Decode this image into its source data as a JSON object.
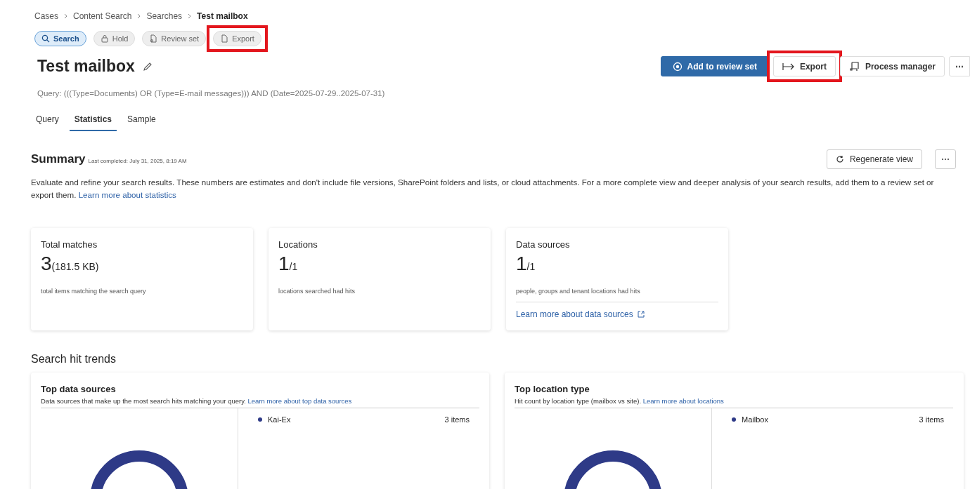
{
  "breadcrumb": [
    {
      "label": "Cases",
      "current": false
    },
    {
      "label": "Content Search",
      "current": false
    },
    {
      "label": "Searches",
      "current": false
    },
    {
      "label": "Test mailbox",
      "current": true
    }
  ],
  "pills": [
    {
      "label": "Search",
      "kind": "search",
      "selected": true,
      "highlighted": false
    },
    {
      "label": "Hold",
      "kind": "hold",
      "selected": false,
      "highlighted": false
    },
    {
      "label": "Review set",
      "kind": "review",
      "selected": false,
      "highlighted": false
    },
    {
      "label": "Export",
      "kind": "export",
      "selected": false,
      "highlighted": true
    }
  ],
  "title": "Test mailbox",
  "actions": [
    {
      "label": "Add to review set",
      "kind": "add",
      "primary": true,
      "highlighted": false
    },
    {
      "label": "Export",
      "kind": "export",
      "primary": false,
      "highlighted": true
    },
    {
      "label": "Process manager",
      "kind": "process",
      "primary": false,
      "highlighted": false
    },
    {
      "label": "⋯",
      "kind": "more",
      "primary": false,
      "highlighted": false
    }
  ],
  "query": "Query: (((Type=Documents) OR (Type=E-mail messages))) AND (Date=2025-07-29..2025-07-31)",
  "tabs": [
    {
      "label": "Query",
      "selected": false
    },
    {
      "label": "Statistics",
      "selected": true
    },
    {
      "label": "Sample",
      "selected": false
    }
  ],
  "summary": {
    "heading": "Summary",
    "last_completed": "Last completed: July 31, 2025, 8:19 AM",
    "regenerate": "Regenerate view",
    "more": "⋯",
    "description": "Evaluate and refine your search results. These numbers are estimates and don't include file versions, SharePoint folders and lists, or cloud attachments. For a more complete view and deeper analysis of your search results, add them to a review set or export them.",
    "link": "Learn more about statistics"
  },
  "cards": [
    {
      "title": "Total matches",
      "big": "3",
      "small": "(181.5 KB)",
      "caption": "total items matching the search query"
    },
    {
      "title": "Locations",
      "big": "1",
      "small": "/1",
      "caption": "locations searched had hits"
    },
    {
      "title": "Data sources",
      "big": "1",
      "small": "/1",
      "caption": "people, groups and tenant locations had hits",
      "link": "Learn more about data sources"
    }
  ],
  "trends_heading": "Search hit trends",
  "panels": [
    {
      "title": "Top data sources",
      "description": "Data sources that make up the most search hits matching your query.",
      "link": "Learn more about top data sources",
      "legend": [
        {
          "label": "Kai-Ex",
          "value": "3 items",
          "color": "#2e3a87"
        }
      ]
    },
    {
      "title": "Top location type",
      "description": "Hit count by location type (mailbox vs site).",
      "link": "Learn more about locations",
      "legend": [
        {
          "label": "Mailbox",
          "value": "3 items",
          "color": "#2e3a87"
        }
      ]
    }
  ]
}
